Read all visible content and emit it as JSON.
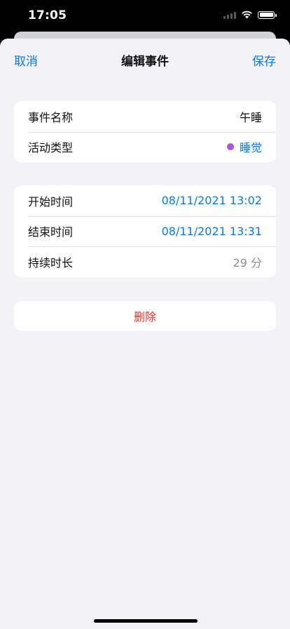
{
  "status_bar": {
    "time": "17:05"
  },
  "nav": {
    "cancel_label": "取消",
    "title": "编辑事件",
    "save_label": "保存"
  },
  "event_group": {
    "name_label": "事件名称",
    "name_value": "午睡",
    "type_label": "活动类型",
    "type_value": "睡觉",
    "type_dot_color": "#af52de"
  },
  "time_group": {
    "start_label": "开始时间",
    "start_value": "08/11/2021 13:02",
    "end_label": "结束时间",
    "end_value": "08/11/2021 13:31",
    "duration_label": "持续时长",
    "duration_value": "29 分"
  },
  "delete_label": "删除",
  "colors": {
    "accent": "#0a7ae5",
    "destructive": "#e5352b",
    "background": "#f2f2f7"
  },
  "icons": [
    "wifi-icon",
    "battery-icon",
    "cellular-signal-icon"
  ]
}
